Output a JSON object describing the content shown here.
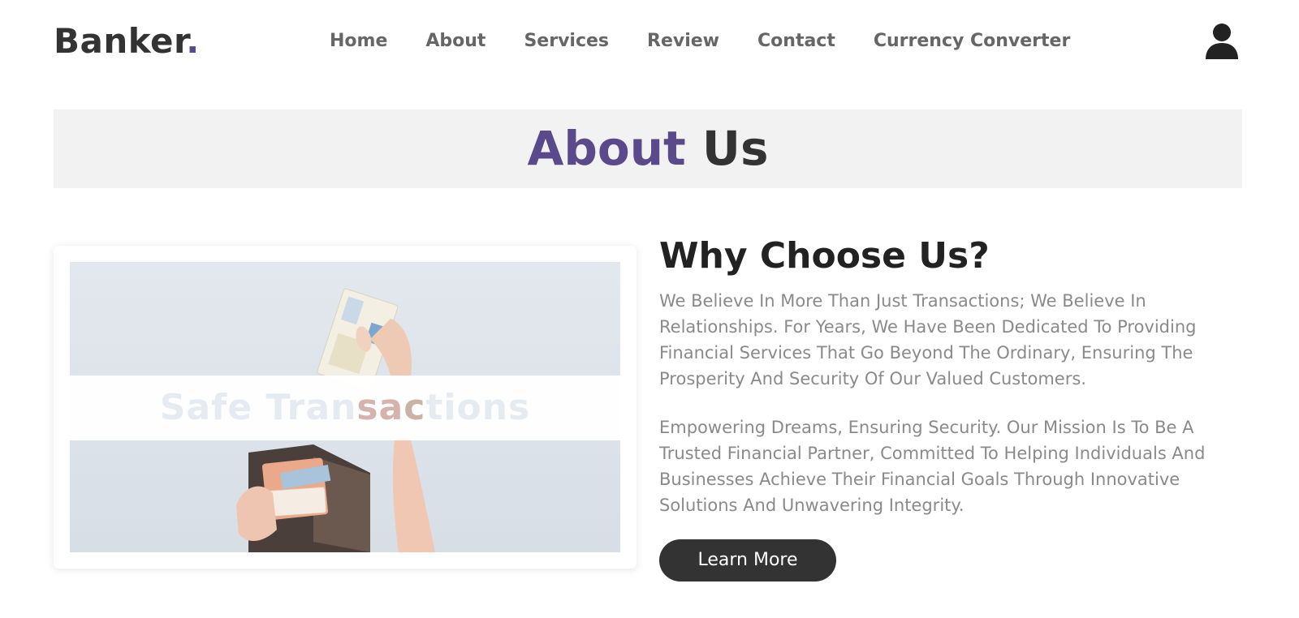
{
  "header": {
    "logo_text": "Banker",
    "logo_dot": ".",
    "nav": [
      {
        "label": "Home"
      },
      {
        "label": "About"
      },
      {
        "label": "Services"
      },
      {
        "label": "Review"
      },
      {
        "label": "Contact"
      },
      {
        "label": "Currency Converter"
      }
    ],
    "user_icon": "user-icon"
  },
  "section_heading": {
    "accent": "About",
    "rest": "Us"
  },
  "image_card": {
    "overlay_parts": [
      "Safe Tran",
      "sa",
      "c",
      "tions"
    ]
  },
  "about": {
    "title": "Why Choose Us?",
    "paragraphs": [
      "We Believe In More Than Just Transactions; We Believe In Relationships. For Years, We Have Been Dedicated To Providing Financial Services That Go Beyond The Ordinary, Ensuring The Prosperity And Security Of Our Valued Customers.",
      "Empowering Dreams, Ensuring Security. Our Mission Is To Be A Trusted Financial Partner, Committed To Helping Individuals And Businesses Achieve Their Financial Goals Through Innovative Solutions And Unwavering Integrity."
    ],
    "button_label": "Learn More"
  },
  "colors": {
    "accent": "#5a4a8c",
    "dark": "#333333",
    "band_bg": "#f2f2f2",
    "muted_text": "#8a8a8a"
  }
}
